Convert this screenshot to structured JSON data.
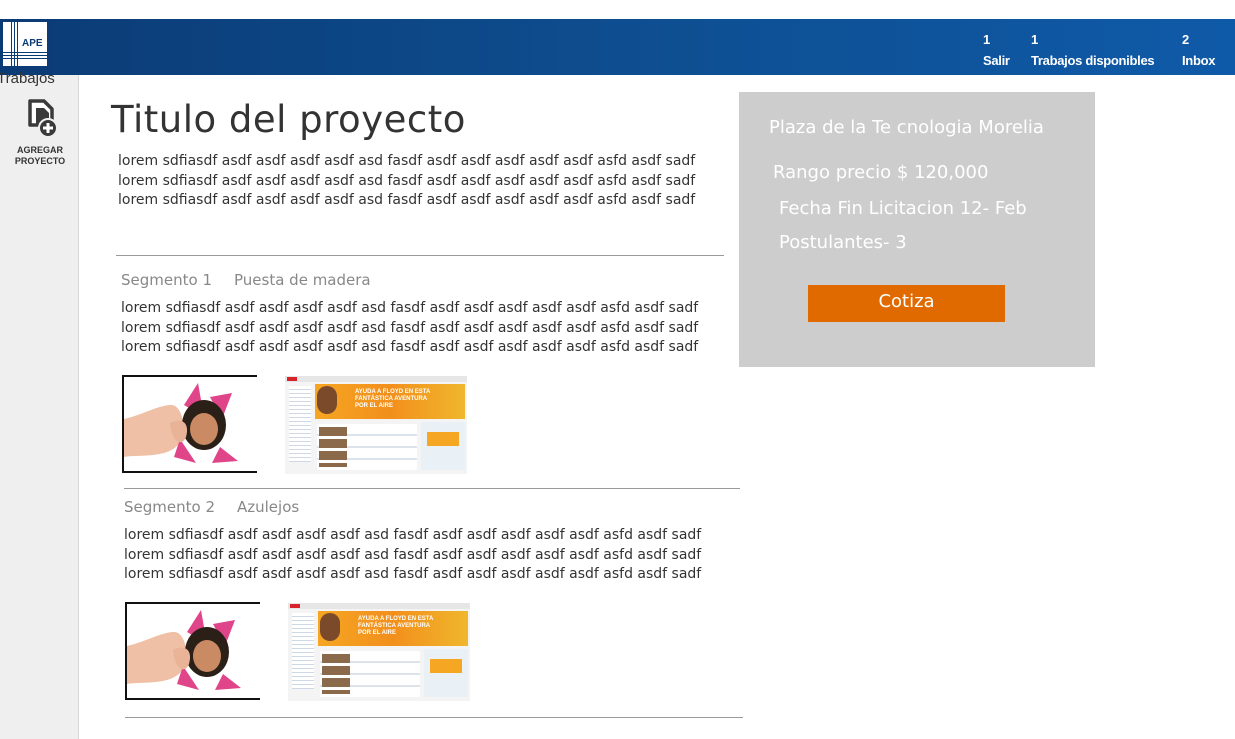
{
  "header": {
    "logo_text": "APE",
    "nav": [
      {
        "count": "1",
        "label": "Salir"
      },
      {
        "count": "1",
        "label": "Trabajos disponibles"
      },
      {
        "count": "2",
        "label": "Inbox"
      }
    ]
  },
  "sidebar": {
    "section_label": "Trabajos",
    "add_project_line1": "AGREGAR",
    "add_project_line2": "PROYECTO",
    "add_project_icon": "add-file-icon"
  },
  "project": {
    "title": "Titulo del proyecto",
    "description": [
      "lorem sdfiasdf asdf asdf asdf asdf asd fasdf asdf asdf asdf asdf asdf asfd asdf sadf",
      "lorem sdfiasdf asdf asdf asdf asdf asd fasdf asdf asdf asdf asdf asdf asfd asdf sadf",
      "lorem sdfiasdf asdf asdf asdf asdf asd fasdf asdf asdf asdf asdf asdf asfd asdf sadf"
    ]
  },
  "segments": [
    {
      "number": "Segmento 1",
      "name": "Puesta de madera",
      "lines": [
        "lorem sdfiasdf asdf asdf asdf asdf asd fasdf asdf asdf asdf asdf asdf asfd asdf sadf",
        "lorem sdfiasdf asdf asdf asdf asdf asd fasdf asdf asdf asdf asdf asdf asfd asdf sadf",
        "lorem sdfiasdf asdf asdf asdf asdf asd fasdf asdf asdf asdf asdf asdf asfd asdf sadf"
      ],
      "banner": {
        "line1": "AYUDA A FLOYD EN ESTA",
        "line2": "FANTÁSTICA AVENTURA",
        "line3": "POR EL AIRE"
      }
    },
    {
      "number": "Segmento 2",
      "name": "Azulejos",
      "lines": [
        "lorem sdfiasdf asdf asdf asdf asdf asd fasdf asdf asdf asdf asdf asdf asfd asdf sadf",
        "lorem sdfiasdf asdf asdf asdf asdf asd fasdf asdf asdf asdf asdf asdf asfd asdf sadf",
        "lorem sdfiasdf asdf asdf asdf asdf asd fasdf asdf asdf asdf asdf asdf asfd asdf sadf"
      ],
      "banner": {
        "line1": "AYUDA A FLOYD EN ESTA",
        "line2": "FANTÁSTICA AVENTURA",
        "line3": "POR EL AIRE"
      }
    }
  ],
  "info_panel": {
    "location": "Plaza  de la Te cnologia Morelia",
    "price_range": "Rango precio $ 120,000",
    "end_date": "Fecha Fin Licitacion 12- Feb",
    "applicants": "Postulantes- 3",
    "quote_button": "Cotiza"
  },
  "colors": {
    "header_blue": "#0e4f92",
    "panel_gray": "#cdcdcd",
    "cta_orange": "#e16a00"
  }
}
